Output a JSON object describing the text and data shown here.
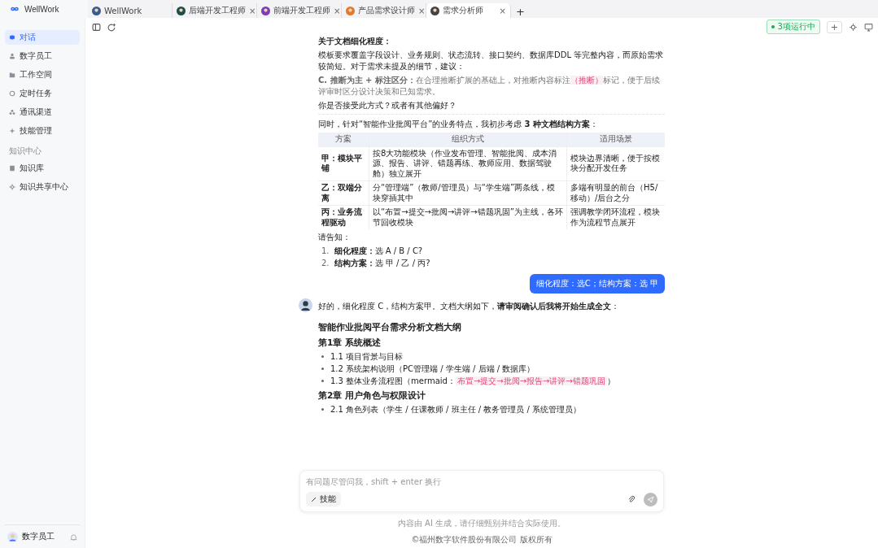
{
  "app": {
    "logo": "WellWork"
  },
  "tabs": [
    {
      "label": "WellWork",
      "selected": false
    },
    {
      "label": "后端开发工程师",
      "selected": false,
      "close": "×"
    },
    {
      "label": "前端开发工程师",
      "selected": false,
      "close": "×"
    },
    {
      "label": "产品需求设计师",
      "selected": false,
      "close": "×"
    },
    {
      "label": "需求分析师",
      "selected": true,
      "close": "×"
    }
  ],
  "new_tab": "+",
  "toolbar": {
    "status": "3项运行中",
    "add": "+"
  },
  "sidebar": {
    "items": [
      {
        "label": "对话",
        "selected": true
      },
      {
        "label": "数字员工",
        "selected": false
      },
      {
        "label": "工作空间",
        "selected": false
      },
      {
        "label": "定时任务",
        "selected": false
      },
      {
        "label": "通讯渠道",
        "selected": false
      },
      {
        "label": "技能管理",
        "selected": false
      }
    ],
    "section_title": "知识中心",
    "knowledge_items": [
      {
        "label": "知识库",
        "selected": false
      },
      {
        "label": "知识共享中心",
        "selected": false
      }
    ],
    "user": {
      "name": "数字员工"
    }
  },
  "chat": {
    "heading": "关于文档细化程度：",
    "paragraph": "模板要求覆盖字段设计、业务规则、状态流转、接口契约、数据库DDL 等完整内容，而原始需求较简短。对于需求未提及的细节，建议：",
    "note": {
      "lead": "C. 推断为主 + 标注区分：",
      "before": "在合理推断扩展的基础上，对推断内容标注",
      "tag": "（推断）",
      "after": "标记，便于后续评审时区分设计决策和已知需求。"
    },
    "question": "你是否接受此方式？或者有其他偏好？",
    "intro": "同时，针对“智能作业批阅平台”的业务特点，我初步考虑 **3 种文档结构方案**：",
    "table": {
      "columns": [
        "方案",
        "组织方式",
        "适用场景"
      ],
      "rows": [
        [
          "甲：模块平铺",
          "按8大功能模块（作业发布管理、智能批阅、成本消源、报告、讲评、错题再练、教师应用、数据驾驶舱）独立展开",
          "模块边界清晰，便于按模块分配开发任务"
        ],
        [
          "乙：双端分离",
          "分“管理端”（教师/管理员）与“学生端”两条线，模块穿插其中",
          "多端有明显的前台（H5/移动）/后台之分"
        ],
        [
          "丙：业务流程驱动",
          "以“布置→提交→批阅→讲评→错题巩固”为主线，各环节回收模块",
          "强调教学闭环流程，模块作为流程节点展开"
        ]
      ]
    },
    "ask": "请告知：",
    "choices": [
      {
        "number": "1.",
        "label": "细化程度：",
        "text": "选 A / B / C?"
      },
      {
        "number": "2.",
        "label": "结构方案：",
        "text": "选 甲 / 乙 / 丙?"
      }
    ],
    "user_message": "细化程度：选C；结构方案：选 甲",
    "reply": "好的，细化程度 C，结构方案甲。文档大纲如下，**请审阅确认后我将开始生成全文**：",
    "outline": {
      "title": "智能作业批阅平台需求分析文档大纲",
      "chapters": [
        {
          "title": "第1章 系统概述",
          "items": [
            {
              "text": "1.1 项目背景与目标"
            },
            {
              "text": "1.2 系统架构说明（PC管理端 / 学生端 / 后端 / 数据库）"
            },
            {
              "text": "1.3 整体业务流程图（mermaid：",
              "code": "布置→提交→批阅→报告→讲评→错题巩固",
              "after": "）"
            }
          ]
        },
        {
          "title": "第2章 用户角色与权限设计",
          "items": [
            {
              "text": "2.1 角色列表（学生 / 任课教师 / 班主任 / 教务管理员 / 系统管理员）"
            }
          ]
        }
      ]
    }
  },
  "composer": {
    "placeholder": "有问题尽管问我，shift + enter 换行",
    "skill_button": "技能"
  },
  "footer": {
    "disclaimer": "内容由 AI 生成，请仔细甄别并结合实际使用。",
    "copyright": "©福州数字软件股份有限公司 版权所有"
  }
}
